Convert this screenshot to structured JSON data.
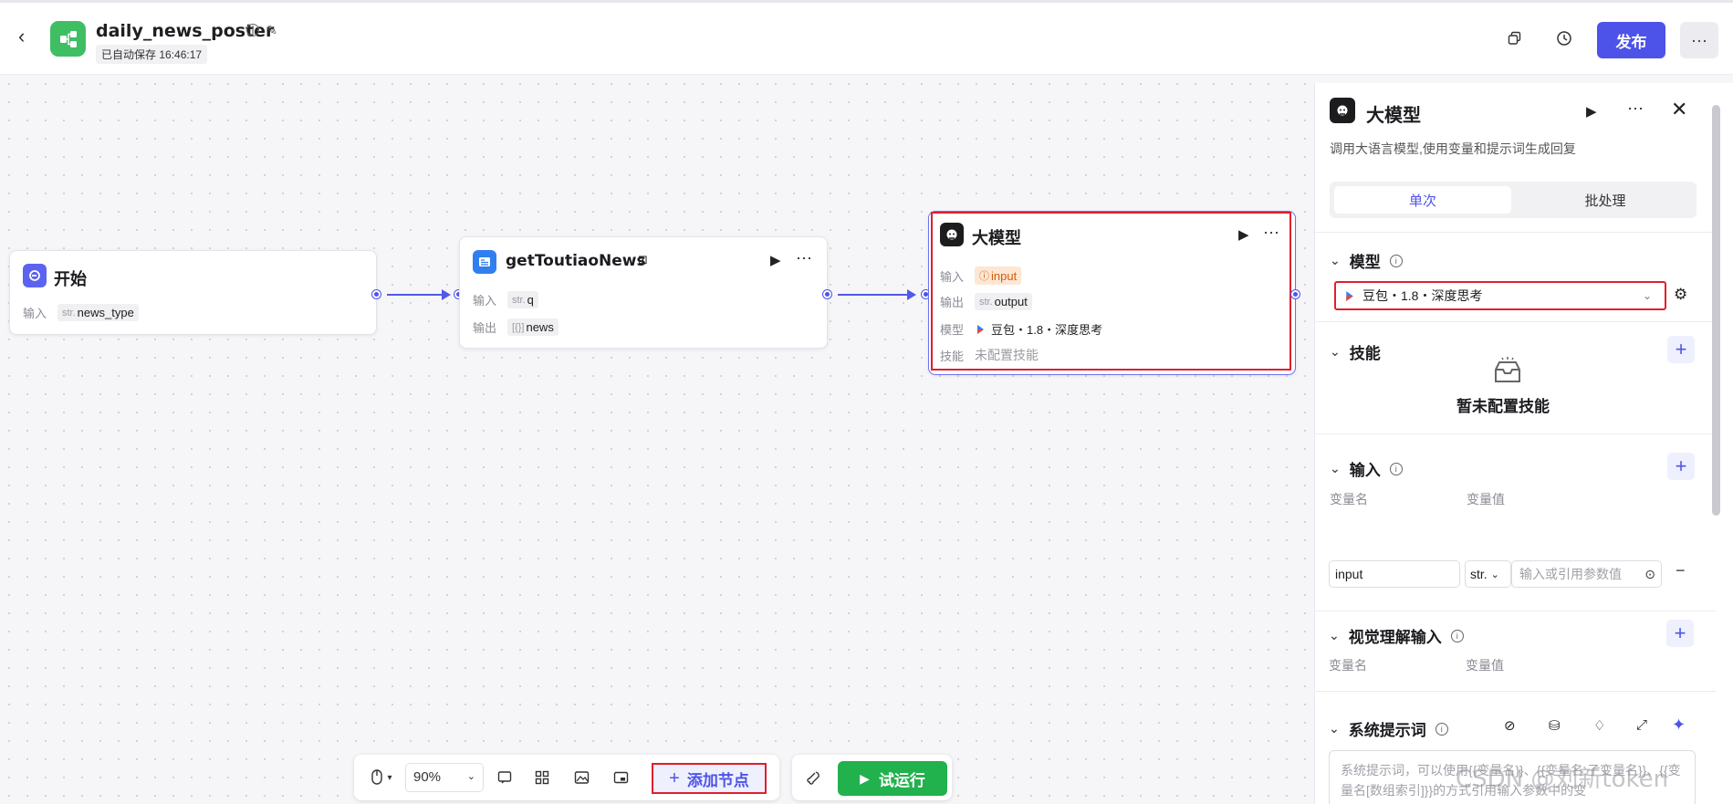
{
  "header": {
    "back_icon": "chevron-left-icon",
    "app_icon": "workflow-icon",
    "title": "daily_news_poster",
    "autosave": "已自动保存 16:46:17",
    "publish_label": "发布",
    "more_label": "···"
  },
  "canvas": {
    "start_node": {
      "title": "开始",
      "input_label": "输入",
      "input_type": "str.",
      "input_name": "news_type"
    },
    "toutiao_node": {
      "title": "getToutiaoNews",
      "input_label": "输入",
      "input_type": "str.",
      "input_name": "q",
      "output_label": "输出",
      "output_type": "[{}]",
      "output_name": "news",
      "more": "···"
    },
    "llm_node": {
      "title": "大模型",
      "input_label": "输入",
      "input_value": "input",
      "output_label": "输出",
      "output_type": "str.",
      "output_name": "output",
      "model_label": "模型",
      "model_value": "豆包・1.8・深度思考",
      "skill_label": "技能",
      "skill_value": "未配置技能",
      "more": "···"
    }
  },
  "toolbar": {
    "zoom": "90%",
    "add_node_label": "添加节点",
    "run_label": "试运行"
  },
  "panel": {
    "title": "大模型",
    "more": "···",
    "description": "调用大语言模型,使用变量和提示词生成回复",
    "tabs": [
      "单次",
      "批处理"
    ],
    "model_section": "模型",
    "model_value": "豆包・1.8・深度思考",
    "skills_section": "技能",
    "skills_empty": "暂未配置技能",
    "input_section": "输入",
    "var_name_label": "变量名",
    "var_value_label": "变量值",
    "input_var_name": "input",
    "input_var_type": "str.",
    "input_var_placeholder": "输入或引用参数值",
    "vision_section": "视觉理解输入",
    "vision_var_name_label": "变量名",
    "vision_var_value_label": "变量值",
    "system_prompt_section": "系统提示词",
    "system_prompt_placeholder": "系统提示词，可以使用{{变量名}}、{{变量名.子变量名}}、{{变量名[数组索引]}}的方式引用输入参数中的变"
  },
  "watermark": "CSDN @刘新token",
  "colors": {
    "accent": "#4d53e8",
    "run": "#21b14d",
    "highlight": "#e01f2d"
  }
}
